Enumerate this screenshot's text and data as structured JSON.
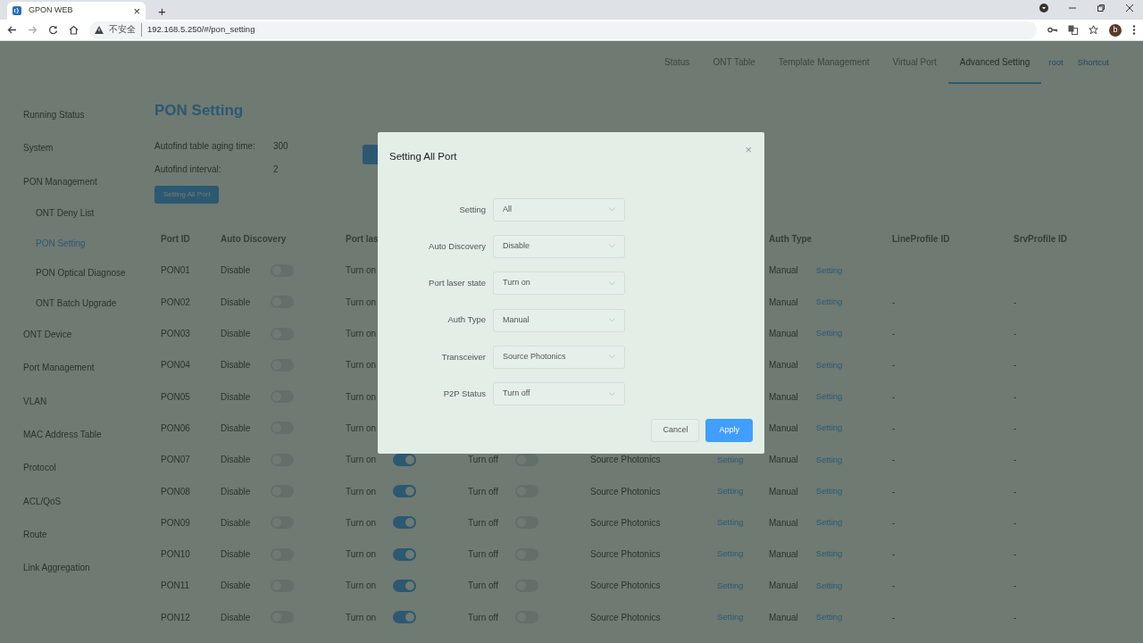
{
  "browser": {
    "tab_title": "GPON WEB",
    "tab_close": "×",
    "new_tab": "+",
    "security_label": "不安全",
    "url": "192.168.5.250/#/pon_setting",
    "profile_initial": "b"
  },
  "top_nav": [
    {
      "label": "Status",
      "selected": false
    },
    {
      "label": "ONT Table",
      "selected": false
    },
    {
      "label": "Template Management",
      "selected": false
    },
    {
      "label": "Virtual Port",
      "selected": false
    },
    {
      "label": "Advanced Setting",
      "selected": true
    }
  ],
  "user_links": [
    "root",
    "Shortcut"
  ],
  "sidebar": {
    "items": [
      {
        "label": "Running Status",
        "selected": false
      },
      {
        "label": "System",
        "selected": false
      },
      {
        "label": "PON Management",
        "selected": false,
        "children": [
          {
            "label": "ONT Deny List",
            "selected": false
          },
          {
            "label": "PON Setting",
            "selected": true
          },
          {
            "label": "PON Optical Diagnose",
            "selected": false
          },
          {
            "label": "ONT Batch Upgrade",
            "selected": false
          }
        ]
      },
      {
        "label": "ONT Device",
        "selected": false
      },
      {
        "label": "Port Management",
        "selected": false
      },
      {
        "label": "VLAN",
        "selected": false
      },
      {
        "label": "MAC Address Table",
        "selected": false
      },
      {
        "label": "Protocol",
        "selected": false
      },
      {
        "label": "ACL/QoS",
        "selected": false
      },
      {
        "label": "Route",
        "selected": false
      },
      {
        "label": "Link Aggregation",
        "selected": false
      }
    ]
  },
  "page": {
    "title": "PON Setting",
    "fields": [
      {
        "label": "Autofind table aging time:",
        "value": "300"
      },
      {
        "label": "Autofind interval:",
        "value": "2"
      }
    ],
    "setting_all_button": "Setting All Port"
  },
  "table": {
    "columns": [
      {
        "label": "Port ID"
      },
      {
        "label": "Auto Discovery"
      },
      {
        "label": "Port las"
      },
      {},
      {},
      {},
      {
        "label": "Auth Type"
      },
      {
        "label": "LineProfile ID"
      },
      {
        "label": "SrvProfile ID"
      }
    ],
    "rows": [
      {
        "port": "PON01",
        "auto_discovery": "Disable",
        "auto_on": false,
        "laser": "Turn on",
        "auth": "Manual",
        "auth_link": "Setting"
      },
      {
        "port": "PON02",
        "auto_discovery": "Disable",
        "auto_on": false,
        "laser": "Turn on",
        "auth": "Manual",
        "auth_link": "Setting",
        "line_profile": "-",
        "srv_profile": "-"
      },
      {
        "port": "PON03",
        "auto_discovery": "Disable",
        "auto_on": false,
        "laser": "Turn on",
        "auth": "Manual",
        "auth_link": "Setting",
        "line_profile": "-",
        "srv_profile": "-"
      },
      {
        "port": "PON04",
        "auto_discovery": "Disable",
        "auto_on": false,
        "laser": "Turn on",
        "auth": "Manual",
        "auth_link": "Setting",
        "line_profile": "-",
        "srv_profile": "-"
      },
      {
        "port": "PON05",
        "auto_discovery": "Disable",
        "auto_on": false,
        "laser": "Turn on",
        "auth": "Manual",
        "auth_link": "Setting",
        "line_profile": "-",
        "srv_profile": "-"
      },
      {
        "port": "PON06",
        "auto_discovery": "Disable",
        "auto_on": false,
        "laser": "Turn on",
        "auth": "Manual",
        "auth_link": "Setting",
        "line_profile": "-",
        "srv_profile": "-"
      },
      {
        "port": "PON07",
        "auto_discovery": "Disable",
        "auto_on": false,
        "laser": "Turn on",
        "laser_on": true,
        "p2p": "Turn off",
        "p2p_on": false,
        "transceiver": "Source Photonics",
        "transceiver_link": "Setting",
        "auth": "Manual",
        "auth_link": "Setting",
        "line_profile": "-",
        "srv_profile": "-"
      },
      {
        "port": "PON08",
        "auto_discovery": "Disable",
        "auto_on": false,
        "laser": "Turn on",
        "laser_on": true,
        "p2p": "Turn off",
        "p2p_on": false,
        "transceiver": "Source Photonics",
        "transceiver_link": "Setting",
        "auth": "Manual",
        "auth_link": "Setting",
        "line_profile": "-",
        "srv_profile": "-"
      },
      {
        "port": "PON09",
        "auto_discovery": "Disable",
        "auto_on": false,
        "laser": "Turn on",
        "laser_on": true,
        "p2p": "Turn off",
        "p2p_on": false,
        "transceiver": "Source Photonics",
        "transceiver_link": "Setting",
        "auth": "Manual",
        "auth_link": "Setting",
        "line_profile": "-",
        "srv_profile": "-"
      },
      {
        "port": "PON10",
        "auto_discovery": "Disable",
        "auto_on": false,
        "laser": "Turn on",
        "laser_on": true,
        "p2p": "Turn off",
        "p2p_on": false,
        "transceiver": "Source Photonics",
        "transceiver_link": "Setting",
        "auth": "Manual",
        "auth_link": "Setting",
        "line_profile": "-",
        "srv_profile": "-"
      },
      {
        "port": "PON11",
        "auto_discovery": "Disable",
        "auto_on": false,
        "laser": "Turn on",
        "laser_on": true,
        "p2p": "Turn off",
        "p2p_on": false,
        "transceiver": "Source Photonics",
        "transceiver_link": "Setting",
        "auth": "Manual",
        "auth_link": "Setting",
        "line_profile": "-",
        "srv_profile": "-"
      },
      {
        "port": "PON12",
        "auto_discovery": "Disable",
        "auto_on": false,
        "laser": "Turn on",
        "laser_on": true,
        "p2p": "Turn off",
        "p2p_on": false,
        "transceiver": "Source Photonics",
        "transceiver_link": "Setting",
        "auth": "Manual",
        "auth_link": "Setting",
        "line_profile": "-",
        "srv_profile": "-"
      }
    ]
  },
  "dialog": {
    "title": "Setting All Port",
    "close": "×",
    "fields": [
      {
        "label": "Setting",
        "value": "All"
      },
      {
        "label": "Auto Discovery",
        "value": "Disable"
      },
      {
        "label": "Port laser state",
        "value": "Turn on"
      },
      {
        "label": "Auth Type",
        "value": "Manual"
      },
      {
        "label": "Transceiver",
        "value": "Source Photonics"
      },
      {
        "label": "P2P Status",
        "value": "Turn off"
      }
    ],
    "buttons": [
      {
        "label": "Cancel",
        "kind": "secondary"
      },
      {
        "label": "Apply",
        "kind": "primary"
      }
    ]
  }
}
